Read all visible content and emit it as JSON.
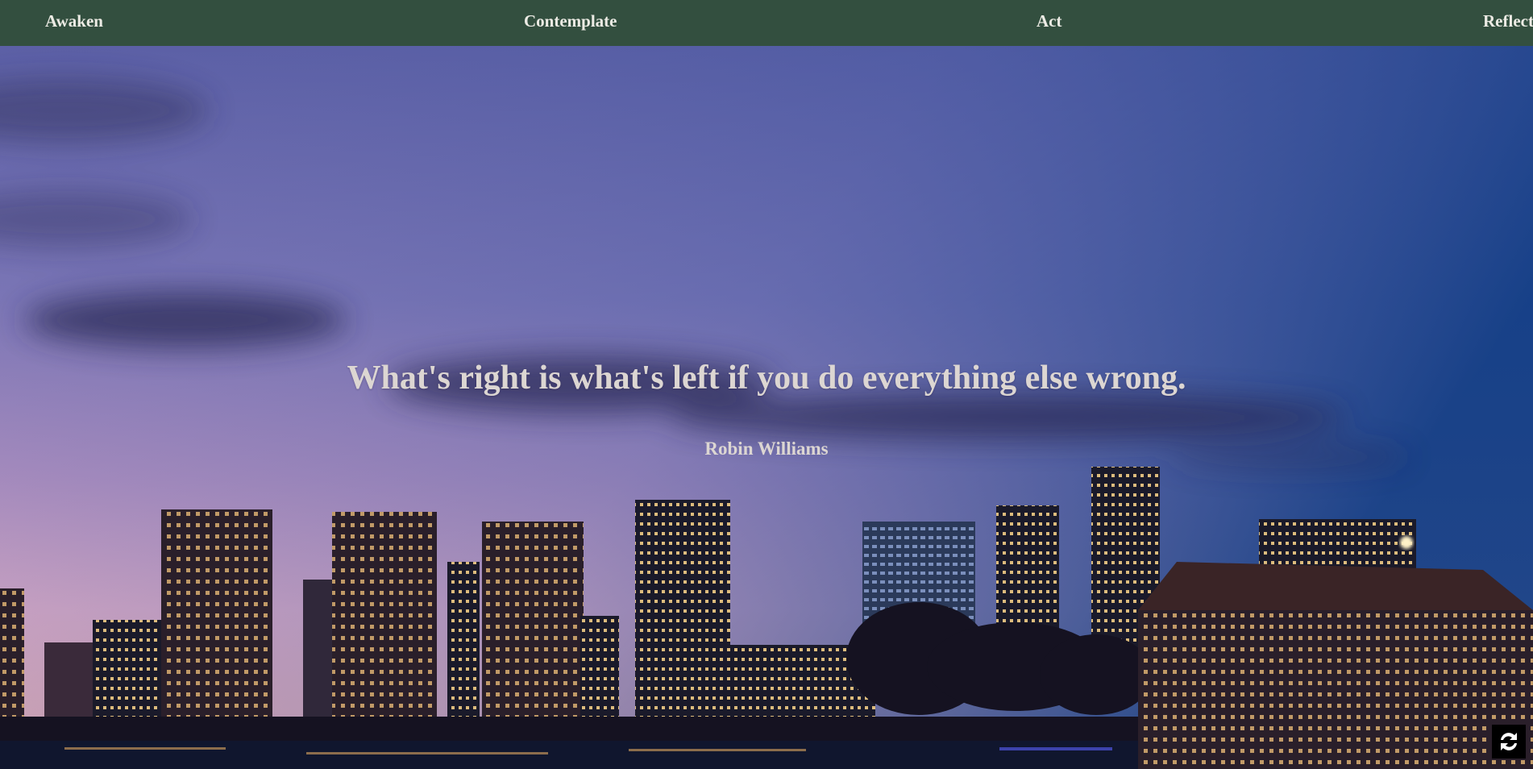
{
  "nav": {
    "items": [
      {
        "label": "Awaken"
      },
      {
        "label": "Contemplate"
      },
      {
        "label": "Act"
      },
      {
        "label": "Reflect"
      }
    ]
  },
  "quote": {
    "text": "What's right is what's left if you do everything else wrong.",
    "author": "Robin Williams"
  },
  "background": {
    "description": "city-skyline-at-dusk-photo",
    "sky_top": "#5763a8",
    "sky_right": "#123c80",
    "sky_horizon": "#d9a8c4",
    "nav_color": "#334f3f",
    "text_color": "#dcd6d2"
  },
  "controls": {
    "refresh_icon": "refresh-icon"
  }
}
